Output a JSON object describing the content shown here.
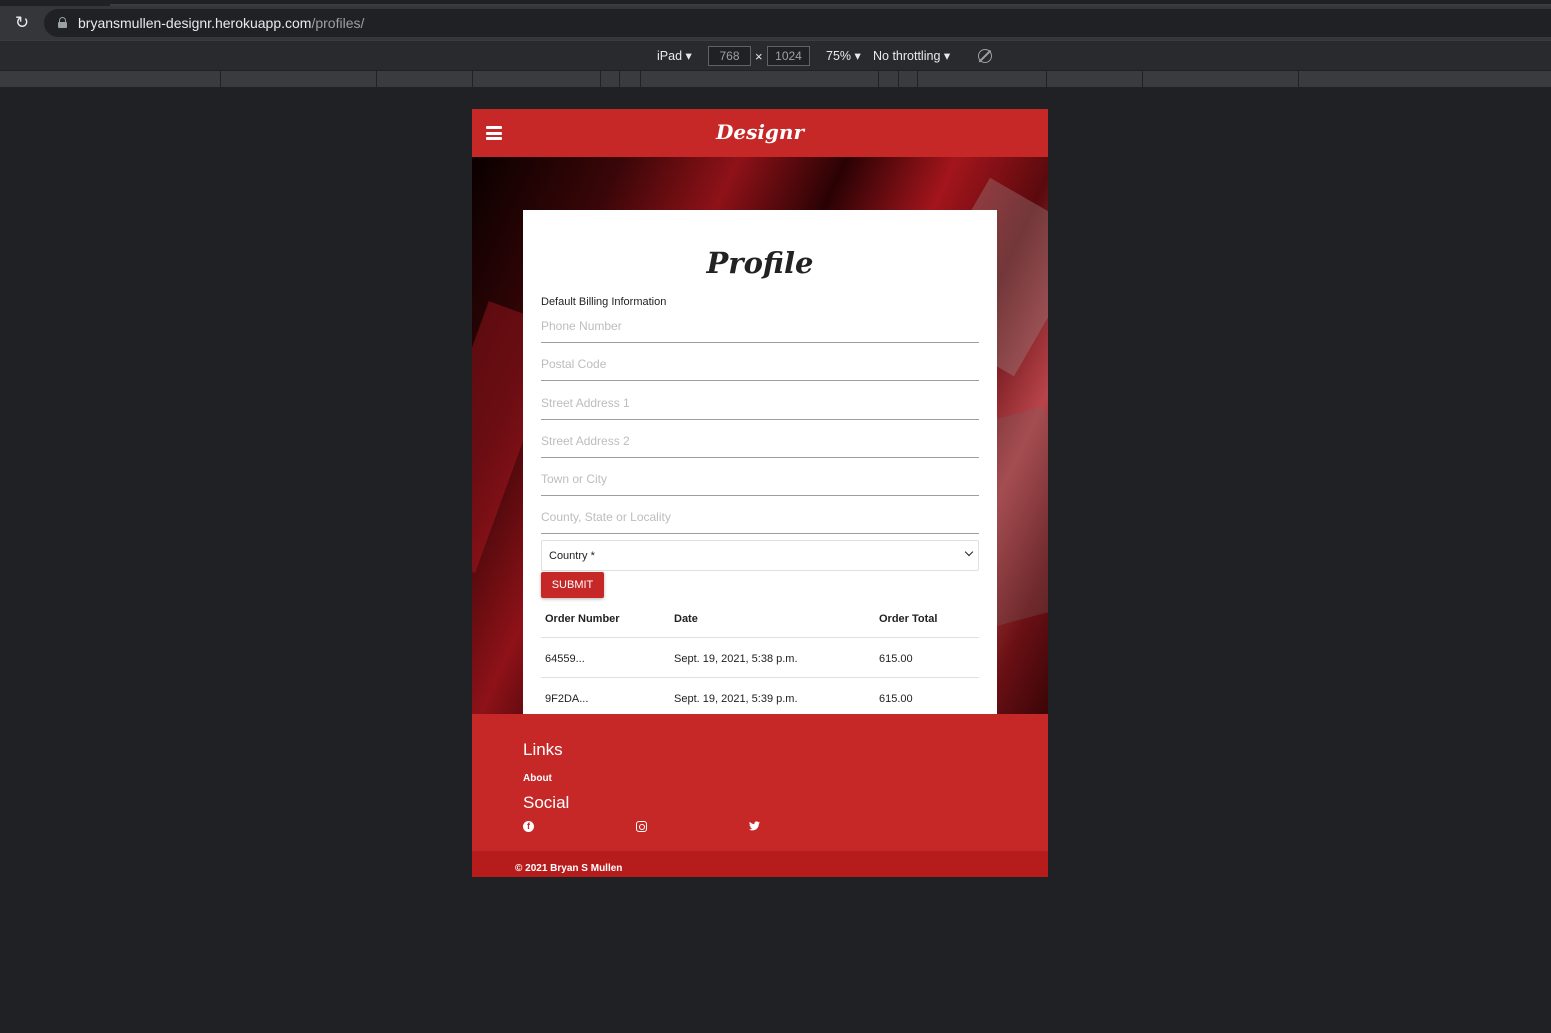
{
  "browser": {
    "url_host": "bryansmullen-designr.herokuapp.com",
    "url_path": "/profiles/",
    "device": "iPad",
    "width": "768",
    "height": "1024",
    "zoom": "75%",
    "throttling": "No throttling",
    "dim_separator": "×"
  },
  "nav": {
    "brand": "Designr"
  },
  "profile": {
    "title": "Profile",
    "section_label": "Default Billing Information",
    "fields": [
      {
        "placeholder": "Phone Number"
      },
      {
        "placeholder": "Postal Code"
      },
      {
        "placeholder": "Street Address 1"
      },
      {
        "placeholder": "Street Address 2"
      },
      {
        "placeholder": "Town or City"
      },
      {
        "placeholder": "County, State or Locality"
      }
    ],
    "country_select": "Country *",
    "submit_label": "SUBMIT"
  },
  "orders": {
    "headers": [
      "Order Number",
      "Date",
      "Order Total"
    ],
    "rows": [
      {
        "number": "64559...",
        "date": "Sept. 19, 2021, 5:38 p.m.",
        "total": "615.00"
      },
      {
        "number": "9F2DA...",
        "date": "Sept. 19, 2021, 5:39 p.m.",
        "total": "615.00"
      }
    ]
  },
  "footer": {
    "links_heading": "Links",
    "about_link": "About",
    "social_heading": "Social",
    "social_icons": [
      "facebook-icon",
      "instagram-icon",
      "twitter-icon"
    ],
    "copyright": "© 2021 Bryan S Mullen"
  },
  "colors": {
    "brand_red": "#c62828",
    "browser_bg": "#202124"
  }
}
